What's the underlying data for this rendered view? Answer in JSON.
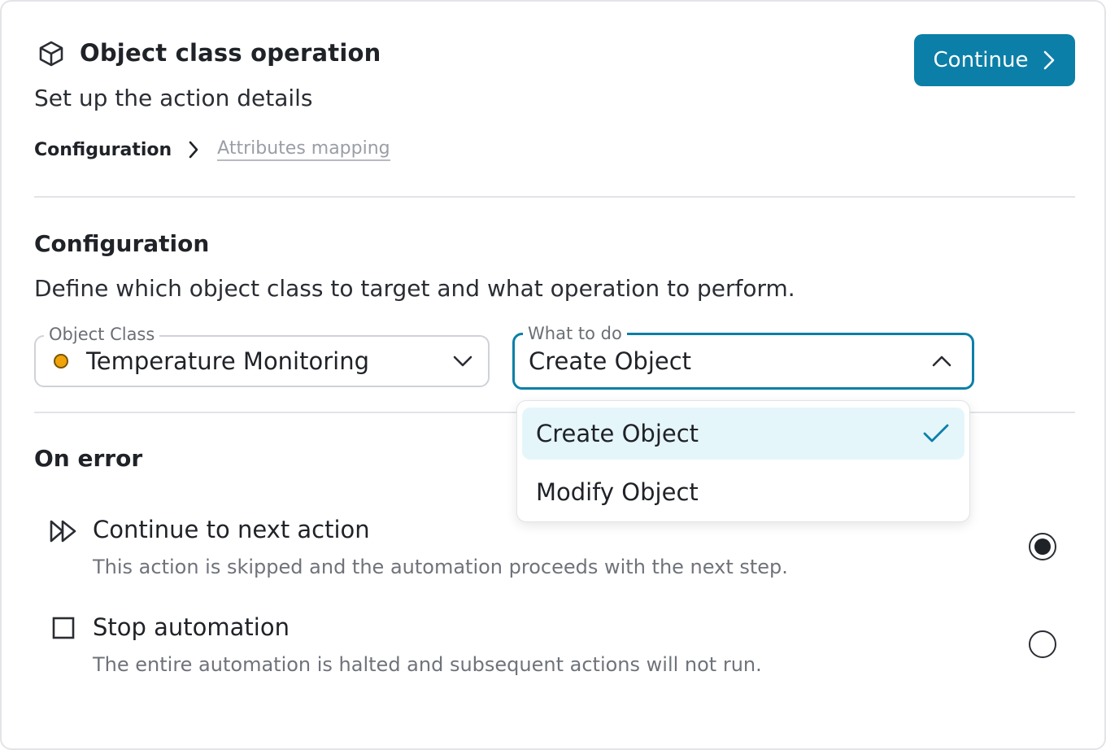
{
  "header": {
    "icon": "cube-icon",
    "title": "Object class operation",
    "subtitle": "Set up the action details",
    "continue_label": "Continue"
  },
  "breadcrumb": {
    "items": [
      {
        "label": "Configuration",
        "active": true
      },
      {
        "label": "Attributes mapping",
        "active": false
      }
    ]
  },
  "configuration": {
    "title": "Configuration",
    "description": "Define which object class to target and what operation to perform.",
    "object_class": {
      "legend": "Object Class",
      "value": "Temperature Monitoring",
      "status_color": "#f0a30a"
    },
    "what_to_do": {
      "legend": "What to do",
      "value": "Create Object",
      "expanded": true,
      "options": [
        {
          "label": "Create Object",
          "selected": true
        },
        {
          "label": "Modify Object",
          "selected": false
        }
      ]
    }
  },
  "on_error": {
    "title": "On error",
    "options": [
      {
        "icon": "fast-forward-icon",
        "label": "Continue to next action",
        "description": "This action is skipped and the automation proceeds with the next step.",
        "selected": true
      },
      {
        "icon": "stop-square-icon",
        "label": "Stop automation",
        "description": "The entire automation is halted and subsequent actions will not run.",
        "selected": false
      }
    ]
  },
  "colors": {
    "accent": "#0b7fa8",
    "selected_item_bg": "#e5f6fb",
    "status_orange": "#f0a30a"
  }
}
